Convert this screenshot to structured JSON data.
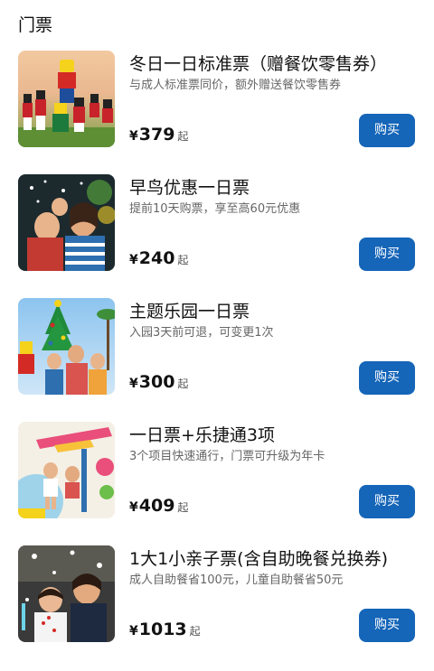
{
  "section": {
    "title": "门票"
  },
  "buy_button_color": "#1565b8",
  "tickets": [
    {
      "name": "冬日一日标准票（赠餐饮零售券）",
      "desc": "与成人标准票同价，额外赠送餐饮零售券",
      "currency": "¥",
      "price": "379",
      "suffix": "起",
      "button": "购买",
      "image": "lego-christmas-toy-soldiers-photo"
    },
    {
      "name": "早鸟优惠一日票",
      "desc": "提前10天购票，享至高60元优惠",
      "currency": "¥",
      "price": "240",
      "suffix": "起",
      "button": "购买",
      "image": "family-photo"
    },
    {
      "name": "主题乐园一日票",
      "desc": "入园3天前可退，可变更1次",
      "currency": "¥",
      "price": "300",
      "suffix": "起",
      "button": "购买",
      "image": "family-lego-christmas-tree-photo"
    },
    {
      "name": "一日票+乐捷通3项",
      "desc": "3个项目快速通行，门票可升级为年卡",
      "currency": "¥",
      "price": "409",
      "suffix": "起",
      "button": "购买",
      "image": "amusement-ride-photo"
    },
    {
      "name": "1大1小亲子票(含自助晚餐兑换券)",
      "desc": "成人自助餐省100元，儿童自助餐省50元",
      "currency": "¥",
      "price": "1013",
      "suffix": "起",
      "button": "购买",
      "image": "parent-child-snow-photo"
    }
  ]
}
